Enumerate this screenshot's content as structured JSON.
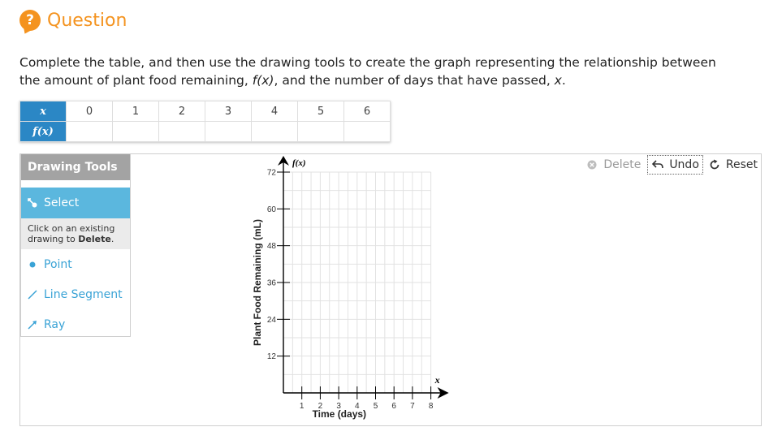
{
  "header": {
    "icon_glyph": "?",
    "title": "Question"
  },
  "prompt": {
    "part1": "Complete the table, and then use the drawing tools to create the graph representing the relationship between the amount of plant food remaining, ",
    "fx": "f(x)",
    "part2": ", and the number of days that have passed, ",
    "x": "x",
    "part3": "."
  },
  "table": {
    "x_label": "x",
    "fx_label": "f(x)",
    "x_values": [
      "0",
      "1",
      "2",
      "3",
      "4",
      "5",
      "6"
    ],
    "fx_values": [
      "",
      "",
      "",
      "",
      "",
      "",
      ""
    ]
  },
  "tools": {
    "header": "Drawing Tools",
    "select": "Select",
    "hint_pre": "Click on an existing drawing to ",
    "hint_bold": "Delete",
    "hint_post": ".",
    "point": "Point",
    "line_segment": "Line Segment",
    "ray": "Ray",
    "select_icon": "pointer-hand-icon",
    "point_icon": "dot-icon",
    "segment_icon": "segment-icon",
    "ray_icon": "ray-icon"
  },
  "buttons": {
    "delete": "Delete",
    "undo": "Undo",
    "reset": "Reset"
  },
  "graph": {
    "xlabel": "Time (days)",
    "ylabel": "Plant Food Remaining (mL)",
    "x_axis_name": "x",
    "y_axis_name": "f(x)",
    "x_ticks": [
      "1",
      "2",
      "3",
      "4",
      "5",
      "6",
      "7",
      "8"
    ],
    "y_ticks": [
      "12",
      "24",
      "36",
      "48",
      "60",
      "72"
    ],
    "xlim": [
      0,
      8
    ],
    "ylim": [
      0,
      72
    ],
    "grid": true
  },
  "colors": {
    "accent": "#f4931f",
    "table_header": "#2b87c5",
    "tool_active": "#5bb7de",
    "tool_link": "#3aa3d6"
  }
}
